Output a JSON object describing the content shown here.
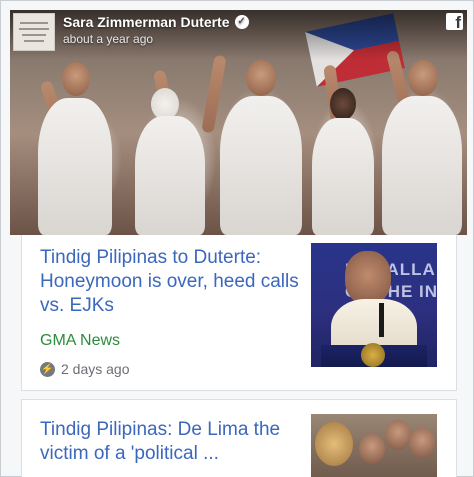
{
  "post": {
    "author": "Sara Zimmerman Duterte",
    "timestamp": "about a year ago",
    "verified_icon": "verified-check-icon",
    "platform_icon": "facebook-icon"
  },
  "articles": [
    {
      "headline": "Tindig Pilipinas to Duterte: Honeymoon is over, heed calls vs. EJKs",
      "source": "GMA News",
      "time": "2 days ago",
      "thumbnail_text": "INSTALLA\nOF THE IN"
    },
    {
      "headline": "Tindig Pilipinas: De Lima the victim of a 'political ..."
    }
  ],
  "colors": {
    "headline": "#3b67bd",
    "source": "#2e8b3c",
    "muted": "#6b6e74"
  }
}
